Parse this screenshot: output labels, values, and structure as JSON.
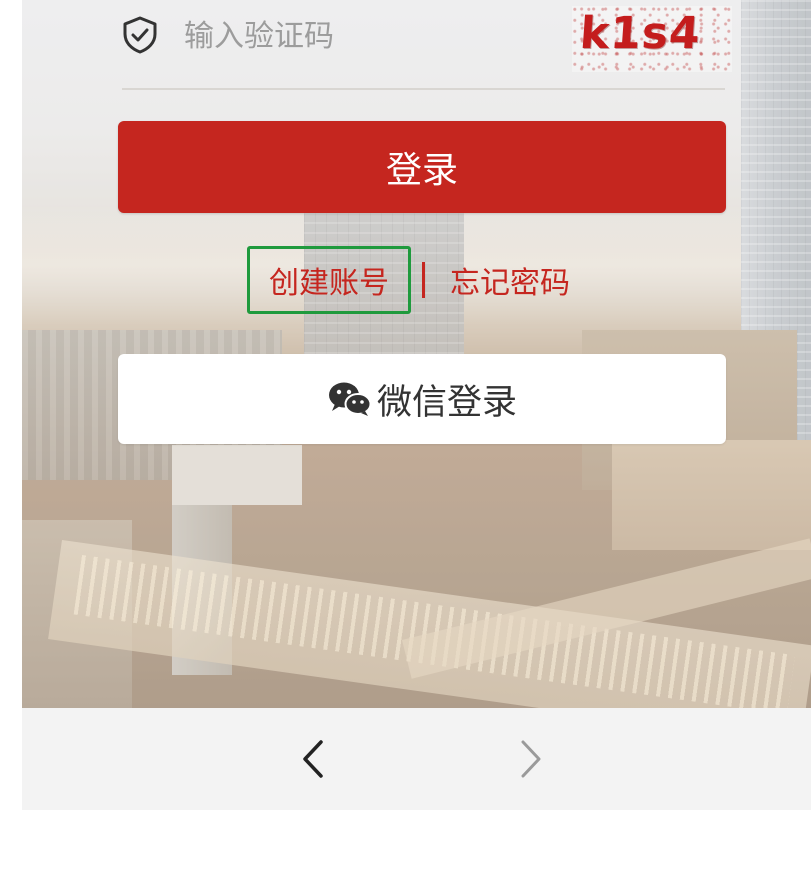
{
  "captcha": {
    "placeholder": "输入验证码",
    "value": "",
    "image_text": "k1s4",
    "icon": "shield-check-icon"
  },
  "login_button": {
    "label": "登录",
    "color": "#c5261f"
  },
  "links": {
    "create_account": "创建账号",
    "divider": "|",
    "forgot_password": "忘记密码",
    "highlight_color": "#1f9a3d"
  },
  "wechat_login": {
    "label": "微信登录",
    "icon": "wechat-icon"
  },
  "bottom_nav": {
    "back_icon": "chevron-left-icon",
    "forward_icon": "chevron-right-icon"
  }
}
